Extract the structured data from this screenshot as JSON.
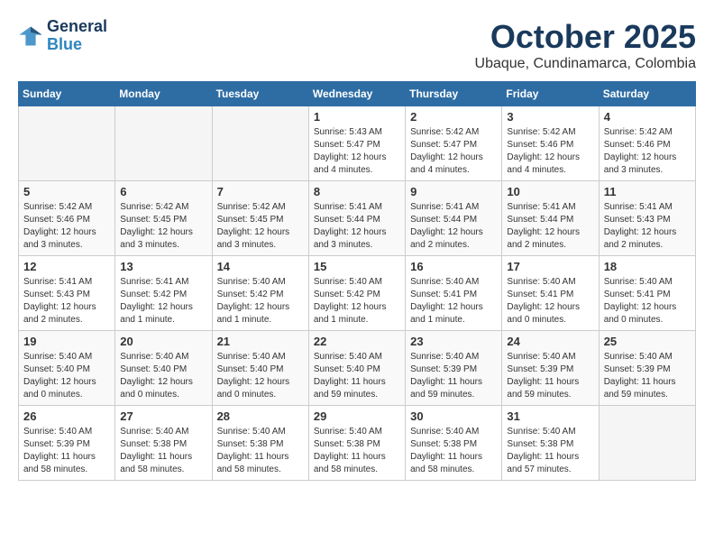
{
  "header": {
    "logo_line1": "General",
    "logo_line2": "Blue",
    "month": "October 2025",
    "location": "Ubaque, Cundinamarca, Colombia"
  },
  "days_of_week": [
    "Sunday",
    "Monday",
    "Tuesday",
    "Wednesday",
    "Thursday",
    "Friday",
    "Saturday"
  ],
  "weeks": [
    [
      {
        "day": "",
        "info": ""
      },
      {
        "day": "",
        "info": ""
      },
      {
        "day": "",
        "info": ""
      },
      {
        "day": "1",
        "info": "Sunrise: 5:43 AM\nSunset: 5:47 PM\nDaylight: 12 hours\nand 4 minutes."
      },
      {
        "day": "2",
        "info": "Sunrise: 5:42 AM\nSunset: 5:47 PM\nDaylight: 12 hours\nand 4 minutes."
      },
      {
        "day": "3",
        "info": "Sunrise: 5:42 AM\nSunset: 5:46 PM\nDaylight: 12 hours\nand 4 minutes."
      },
      {
        "day": "4",
        "info": "Sunrise: 5:42 AM\nSunset: 5:46 PM\nDaylight: 12 hours\nand 3 minutes."
      }
    ],
    [
      {
        "day": "5",
        "info": "Sunrise: 5:42 AM\nSunset: 5:46 PM\nDaylight: 12 hours\nand 3 minutes."
      },
      {
        "day": "6",
        "info": "Sunrise: 5:42 AM\nSunset: 5:45 PM\nDaylight: 12 hours\nand 3 minutes."
      },
      {
        "day": "7",
        "info": "Sunrise: 5:42 AM\nSunset: 5:45 PM\nDaylight: 12 hours\nand 3 minutes."
      },
      {
        "day": "8",
        "info": "Sunrise: 5:41 AM\nSunset: 5:44 PM\nDaylight: 12 hours\nand 3 minutes."
      },
      {
        "day": "9",
        "info": "Sunrise: 5:41 AM\nSunset: 5:44 PM\nDaylight: 12 hours\nand 2 minutes."
      },
      {
        "day": "10",
        "info": "Sunrise: 5:41 AM\nSunset: 5:44 PM\nDaylight: 12 hours\nand 2 minutes."
      },
      {
        "day": "11",
        "info": "Sunrise: 5:41 AM\nSunset: 5:43 PM\nDaylight: 12 hours\nand 2 minutes."
      }
    ],
    [
      {
        "day": "12",
        "info": "Sunrise: 5:41 AM\nSunset: 5:43 PM\nDaylight: 12 hours\nand 2 minutes."
      },
      {
        "day": "13",
        "info": "Sunrise: 5:41 AM\nSunset: 5:42 PM\nDaylight: 12 hours\nand 1 minute."
      },
      {
        "day": "14",
        "info": "Sunrise: 5:40 AM\nSunset: 5:42 PM\nDaylight: 12 hours\nand 1 minute."
      },
      {
        "day": "15",
        "info": "Sunrise: 5:40 AM\nSunset: 5:42 PM\nDaylight: 12 hours\nand 1 minute."
      },
      {
        "day": "16",
        "info": "Sunrise: 5:40 AM\nSunset: 5:41 PM\nDaylight: 12 hours\nand 1 minute."
      },
      {
        "day": "17",
        "info": "Sunrise: 5:40 AM\nSunset: 5:41 PM\nDaylight: 12 hours\nand 0 minutes."
      },
      {
        "day": "18",
        "info": "Sunrise: 5:40 AM\nSunset: 5:41 PM\nDaylight: 12 hours\nand 0 minutes."
      }
    ],
    [
      {
        "day": "19",
        "info": "Sunrise: 5:40 AM\nSunset: 5:40 PM\nDaylight: 12 hours\nand 0 minutes."
      },
      {
        "day": "20",
        "info": "Sunrise: 5:40 AM\nSunset: 5:40 PM\nDaylight: 12 hours\nand 0 minutes."
      },
      {
        "day": "21",
        "info": "Sunrise: 5:40 AM\nSunset: 5:40 PM\nDaylight: 12 hours\nand 0 minutes."
      },
      {
        "day": "22",
        "info": "Sunrise: 5:40 AM\nSunset: 5:40 PM\nDaylight: 11 hours\nand 59 minutes."
      },
      {
        "day": "23",
        "info": "Sunrise: 5:40 AM\nSunset: 5:39 PM\nDaylight: 11 hours\nand 59 minutes."
      },
      {
        "day": "24",
        "info": "Sunrise: 5:40 AM\nSunset: 5:39 PM\nDaylight: 11 hours\nand 59 minutes."
      },
      {
        "day": "25",
        "info": "Sunrise: 5:40 AM\nSunset: 5:39 PM\nDaylight: 11 hours\nand 59 minutes."
      }
    ],
    [
      {
        "day": "26",
        "info": "Sunrise: 5:40 AM\nSunset: 5:39 PM\nDaylight: 11 hours\nand 58 minutes."
      },
      {
        "day": "27",
        "info": "Sunrise: 5:40 AM\nSunset: 5:38 PM\nDaylight: 11 hours\nand 58 minutes."
      },
      {
        "day": "28",
        "info": "Sunrise: 5:40 AM\nSunset: 5:38 PM\nDaylight: 11 hours\nand 58 minutes."
      },
      {
        "day": "29",
        "info": "Sunrise: 5:40 AM\nSunset: 5:38 PM\nDaylight: 11 hours\nand 58 minutes."
      },
      {
        "day": "30",
        "info": "Sunrise: 5:40 AM\nSunset: 5:38 PM\nDaylight: 11 hours\nand 58 minutes."
      },
      {
        "day": "31",
        "info": "Sunrise: 5:40 AM\nSunset: 5:38 PM\nDaylight: 11 hours\nand 57 minutes."
      },
      {
        "day": "",
        "info": ""
      }
    ]
  ]
}
